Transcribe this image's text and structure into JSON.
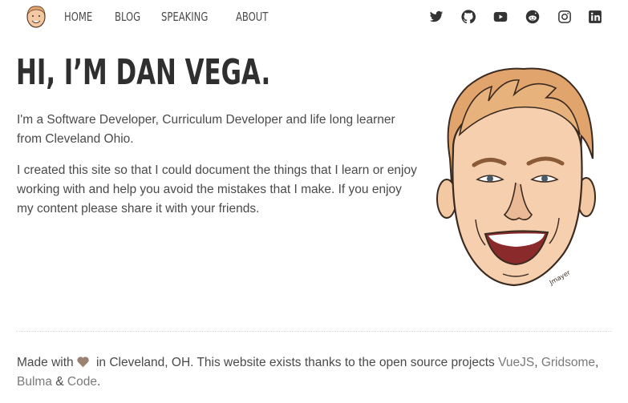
{
  "nav": {
    "links": [
      {
        "label": "HOME"
      },
      {
        "label": "BLOG"
      },
      {
        "label": "SPEAKING"
      },
      {
        "label": "ABOUT"
      }
    ],
    "social_icons": [
      "twitter-icon",
      "github-icon",
      "youtube-icon",
      "reddit-icon",
      "instagram-icon",
      "linkedin-icon"
    ]
  },
  "hero": {
    "title": "HI, I’M DAN VEGA.",
    "paragraph1": "I'm a Software Developer, Curriculum Developer and life long learner from Cleveland Ohio.",
    "paragraph2": "I created this site so that I could document the things that I learn or enjoy working with and help you avoid the mistakes that I make. If you enjoy my content please share it with your friends.",
    "portrait_signature": "Jmayer"
  },
  "footer": {
    "made_with": "Made with",
    "location_text": "in Cleveland, OH. This website exists thanks to the open source projects",
    "links": [
      "VueJS",
      "Gridsome",
      "Bulma",
      "Code"
    ],
    "sep_comma": ",",
    "sep_amp": "&",
    "end": "."
  },
  "colors": {
    "text": "#4a4a4a",
    "heading": "#2f2f2f",
    "link": "#7a7a7a",
    "heart": "#9c8272",
    "skin": "#f3c9a4",
    "hair": "#e0a46c"
  }
}
